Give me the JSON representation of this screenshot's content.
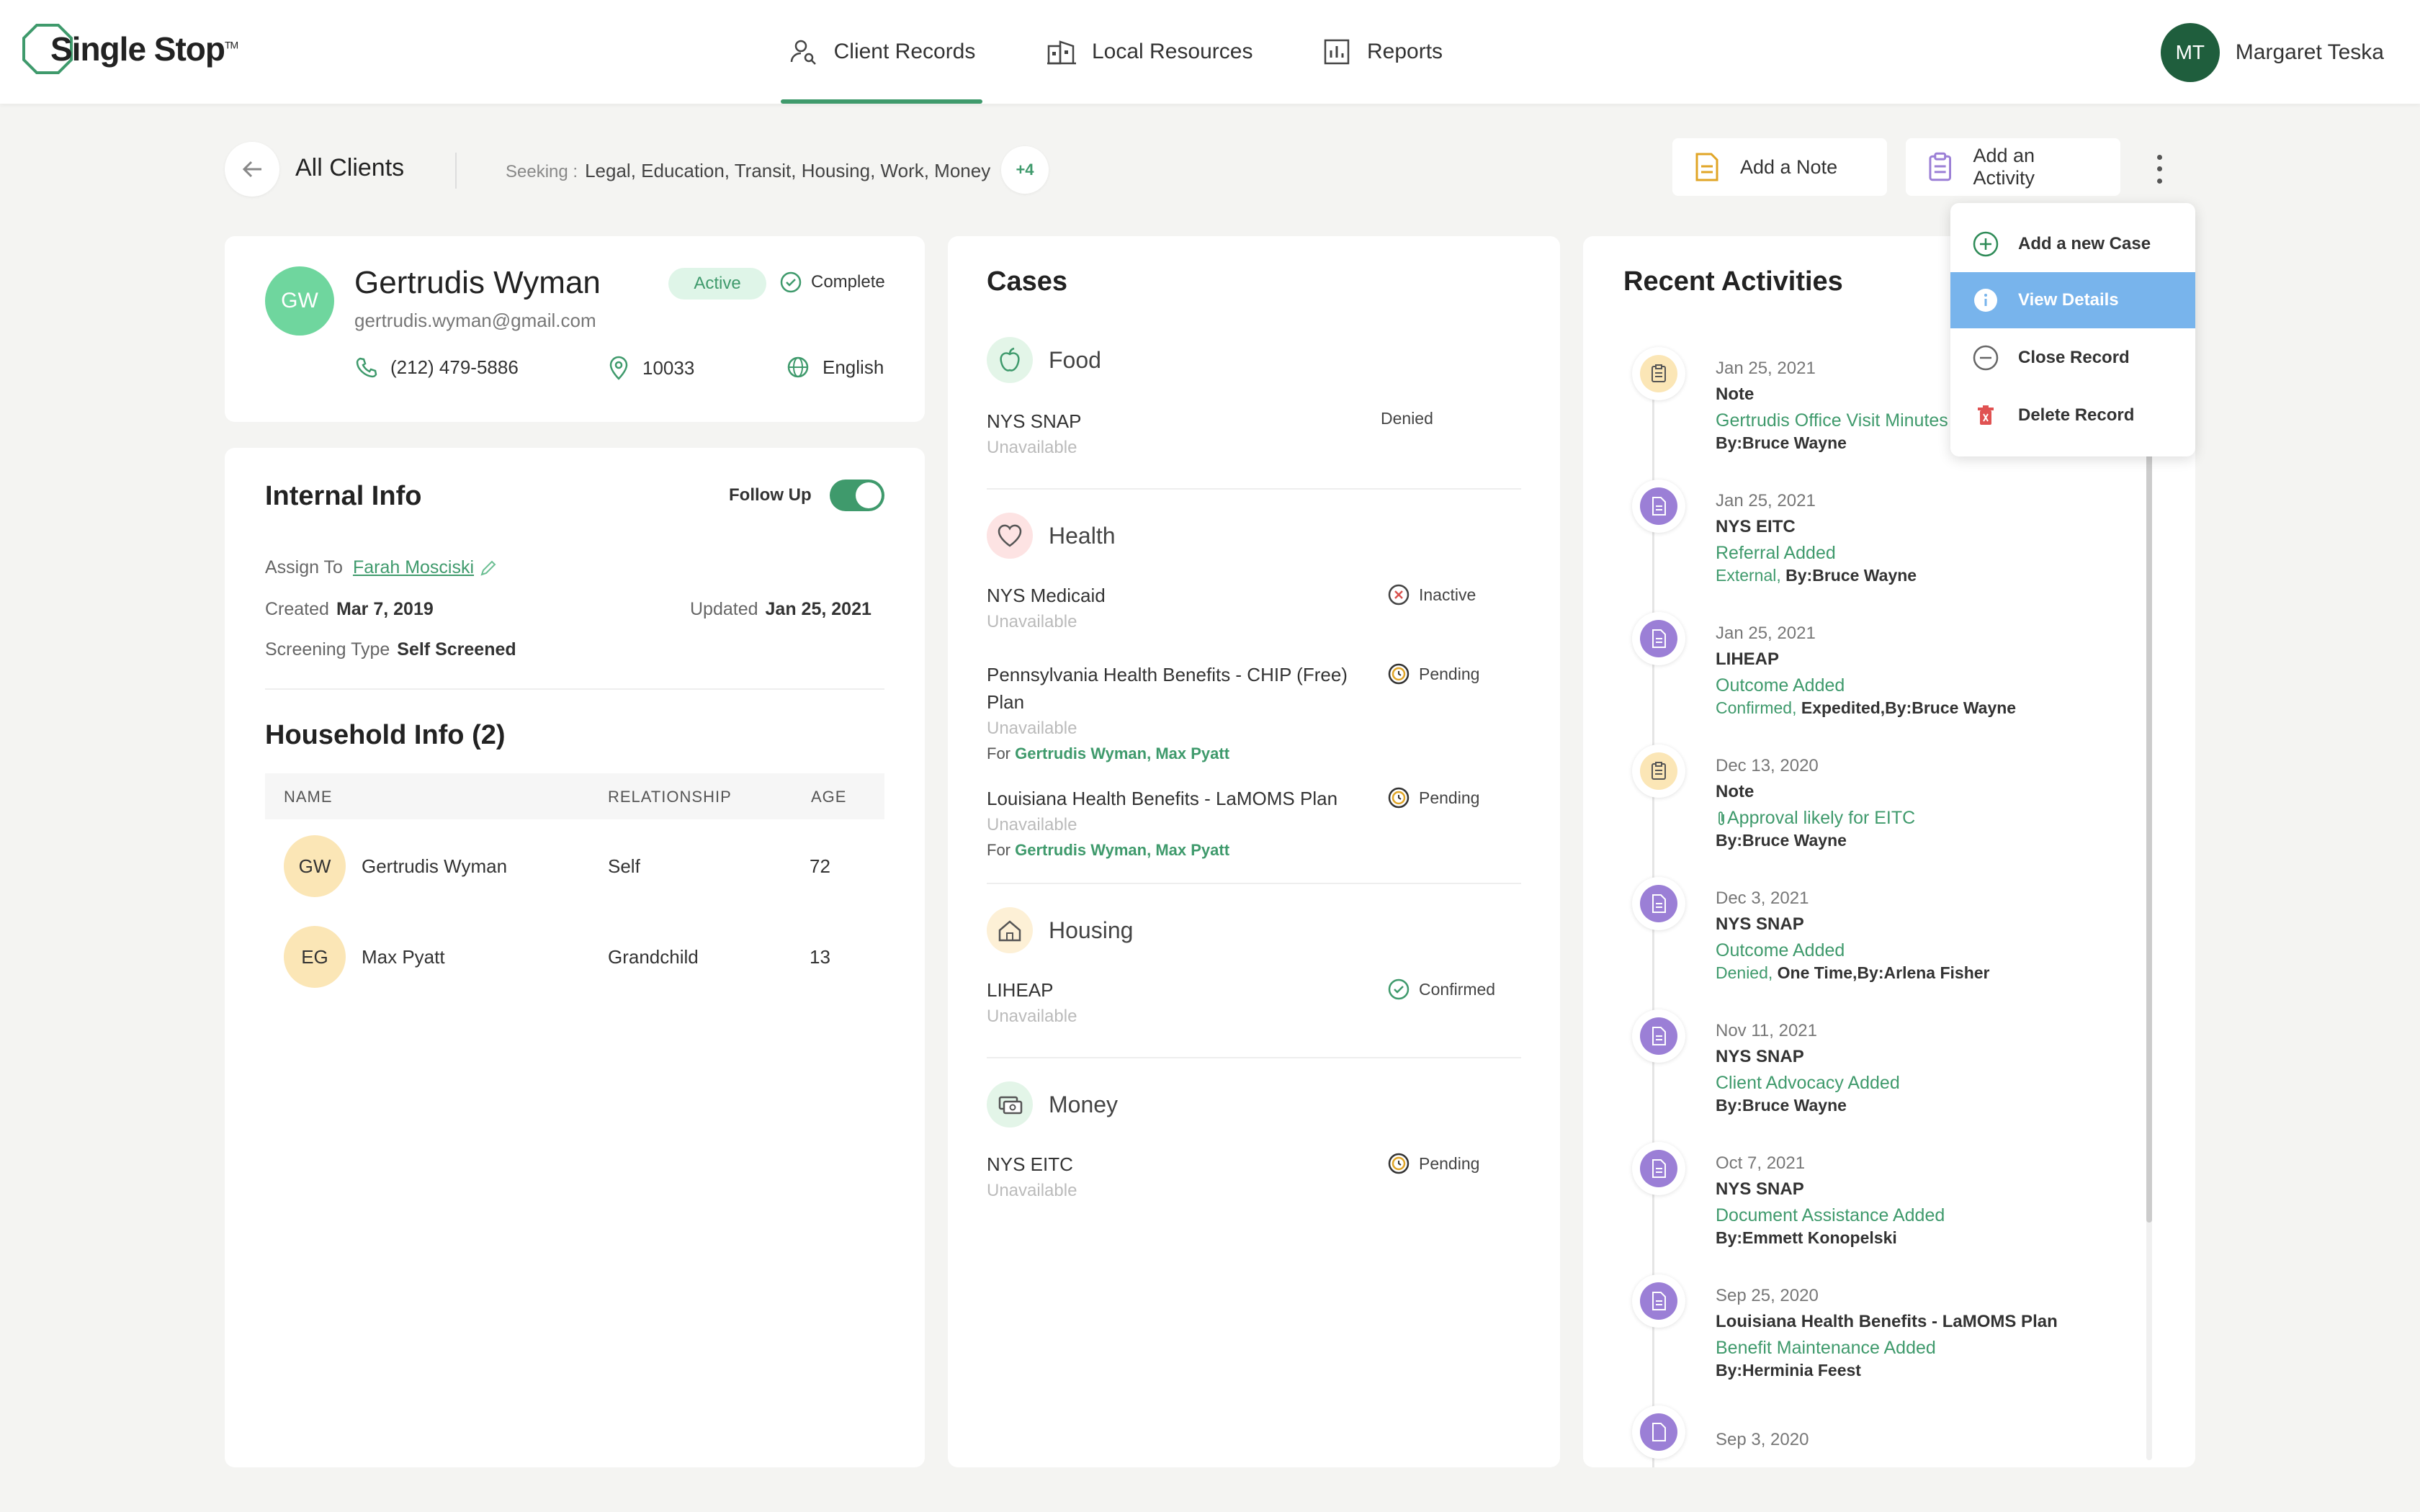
{
  "app": {
    "logo_text": "Single Stop",
    "logo_tm": "TM"
  },
  "nav": {
    "items": [
      {
        "label": "Client Records",
        "icon": "user-search-icon",
        "active": true
      },
      {
        "label": "Local Resources",
        "icon": "building-icon",
        "active": false
      },
      {
        "label": "Reports",
        "icon": "bar-chart-icon",
        "active": false
      }
    ]
  },
  "user": {
    "initials": "MT",
    "name": "Margaret Teska"
  },
  "toolbar": {
    "back_label": "All Clients",
    "seeking_label": "Seeking :",
    "seeking_value": "Legal, Education, Transit, Housing, Work, Money",
    "more_count": "+4",
    "add_note": "Add a Note",
    "add_activity": "Add an Activity"
  },
  "client": {
    "initials": "GW",
    "name": "Gertrudis Wyman",
    "email": "gertrudis.wyman@gmail.com",
    "status": "Active",
    "completion": "Complete",
    "phone": "(212) 479-5886",
    "zip": "10033",
    "language": "English"
  },
  "internal": {
    "title": "Internal Info",
    "follow_up_label": "Follow Up",
    "follow_up_on": true,
    "assign_label": "Assign To",
    "assign_value": "Farah Mosciski",
    "created_label": "Created",
    "created_value": "Mar 7, 2019",
    "updated_label": "Updated",
    "updated_value": "Jan 25, 2021",
    "screening_label": "Screening Type",
    "screening_value": "Self Screened"
  },
  "household": {
    "title": "Household Info (2)",
    "columns": [
      "NAME",
      "RELATIONSHIP",
      "AGE"
    ],
    "rows": [
      {
        "initials": "GW",
        "name": "Gertrudis Wyman",
        "relationship": "Self",
        "age": "72"
      },
      {
        "initials": "EG",
        "name": "Max Pyatt",
        "relationship": "Grandchild",
        "age": "13"
      }
    ]
  },
  "cases": {
    "title": "Cases",
    "categories": [
      {
        "name": "Food",
        "icon": "apple-icon",
        "items": [
          {
            "name": "NYS SNAP",
            "sub": "Unavailable",
            "status": "Denied"
          }
        ]
      },
      {
        "name": "Health",
        "icon": "heart-icon",
        "items": [
          {
            "name": "NYS Medicaid",
            "sub": "Unavailable",
            "status": "Inactive"
          },
          {
            "name_line1": "Pennsylvania Health Benefits - CHIP (Free)",
            "name_line2": "Plan",
            "sub": "Unavailable",
            "for_label": "For",
            "for_value": "Gertrudis Wyman, Max Pyatt",
            "status": "Pending"
          },
          {
            "name": "Louisiana Health Benefits - LaMOMS Plan",
            "sub": "Unavailable",
            "for_label": "For",
            "for_value": "Gertrudis Wyman, Max Pyatt",
            "status": "Pending"
          }
        ]
      },
      {
        "name": "Housing",
        "icon": "house-icon",
        "items": [
          {
            "name": "LIHEAP",
            "sub": "Unavailable",
            "status": "Confirmed"
          }
        ]
      },
      {
        "name": "Money",
        "icon": "money-icon",
        "items": [
          {
            "name": "NYS EITC",
            "sub": "Unavailable",
            "status": "Pending"
          }
        ]
      }
    ]
  },
  "activities": {
    "title": "Recent Activities",
    "items": [
      {
        "type": "note",
        "date": "Jan 25, 2021",
        "program": "Note",
        "event": "Gertrudis Office Visit Minutes",
        "by": "By:Bruce Wayne"
      },
      {
        "type": "doc",
        "date": "Jan 25, 2021",
        "program": "NYS EITC",
        "event": "Referral Added",
        "by_green": "External,",
        "by": "By:Bruce Wayne"
      },
      {
        "type": "doc",
        "date": "Jan 25, 2021",
        "program": "LIHEAP",
        "event": "Outcome Added",
        "by_green": "Confirmed,",
        "by": "Expedited,By:Bruce Wayne"
      },
      {
        "type": "note",
        "date": "Dec 13, 2020",
        "program": "Note",
        "event": "Approval likely for EITC",
        "by": "By:Bruce Wayne"
      },
      {
        "type": "doc",
        "date": "Dec 3, 2021",
        "program": "NYS SNAP",
        "event": "Outcome Added",
        "by_green": "Denied,",
        "by": "One Time,By:Arlena Fisher"
      },
      {
        "type": "doc",
        "date": "Nov 11, 2021",
        "program": "NYS SNAP",
        "event": "Client Advocacy Added",
        "by": "By:Bruce Wayne"
      },
      {
        "type": "doc",
        "date": "Oct 7, 2021",
        "program": "NYS SNAP",
        "event": "Document Assistance Added",
        "by": "By:Emmett Konopelski"
      },
      {
        "type": "doc",
        "date": "Sep 25, 2020",
        "program": "Louisiana Health Benefits - LaMOMS Plan",
        "event": "Benefit Maintenance Added",
        "by": "By:Herminia Feest"
      },
      {
        "type": "doc",
        "date": "Sep 3, 2020"
      }
    ]
  },
  "menu": {
    "items": [
      {
        "label": "Add a new Case",
        "icon": "plus-circle-icon"
      },
      {
        "label": "View Details",
        "icon": "info-icon",
        "active": true
      },
      {
        "label": "Close Record",
        "icon": "minus-circle-icon"
      },
      {
        "label": "Delete Record",
        "icon": "trash-icon"
      }
    ]
  },
  "colors": {
    "accent": "#3f9a6c",
    "purple": "#9b7fd6",
    "note_yellow": "#fbe6b6",
    "menu_active": "#78b4ec"
  }
}
